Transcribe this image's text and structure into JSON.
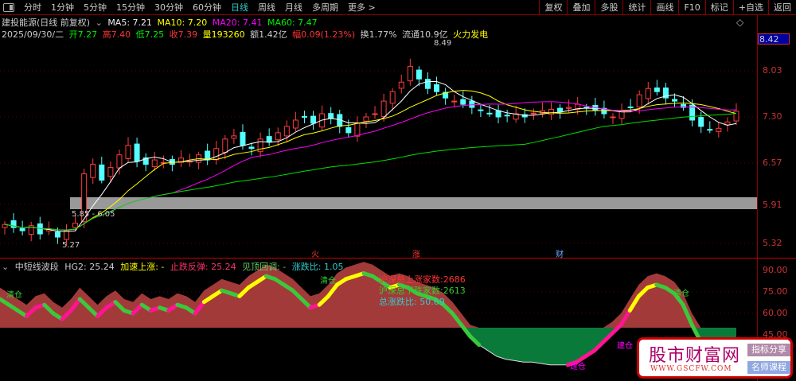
{
  "toolbar": {
    "tabs": [
      "分时",
      "1分钟",
      "5分钟",
      "15分钟",
      "30分钟",
      "60分钟",
      "日线",
      "周线",
      "月线",
      "多周期",
      "更多 >"
    ],
    "active": 6,
    "right": [
      "复权",
      "叠加",
      "多股",
      "统计",
      "画线",
      "F10",
      "标记",
      "+自选",
      "返回"
    ]
  },
  "info": {
    "title": "建投能源(日线 前复权)",
    "ma5": "MA5: 7.21",
    "ma10": "MA10: 7.20",
    "ma20": "MA20: 7.41",
    "ma60": "MA60: 7.47",
    "date": "2025/09/30/二",
    "open": "开7.27",
    "high": "高7.40",
    "low": "低7.25",
    "close": "收7.39",
    "vol": "量193260",
    "amt": "额1.42亿",
    "chg": "幅0.09(1.23%)",
    "turn": "换1.77%",
    "float": "流通10.9亿",
    "sector": "火力发电"
  },
  "price_axis": {
    "current": "8.42",
    "ticks": [
      "8.03",
      "7.30",
      "6.57",
      "5.91",
      "5.32"
    ]
  },
  "annotations": {
    "high": "8.49",
    "low": "5.27",
    "band": "5.85 - 6.05",
    "markers": [
      "火",
      "涨",
      "财"
    ]
  },
  "indicator": {
    "name": "中短线波段",
    "hg2": "HG2: 25.24",
    "acc": "加速上涨: -",
    "rebound": "止跌反弹: 25.24",
    "top": "见顶回调: -",
    "ratio": "涨跌比: 1.05",
    "ticks": [
      "90.00",
      "75.00",
      "60.00",
      "45.00"
    ],
    "up": "沪深总上涨家数:2686",
    "down": "沪深总下跌家数:2613",
    "total": "总涨跌比: 50.69",
    "labels": [
      "清仓",
      "建仓"
    ]
  },
  "watermark": {
    "name": "股市财富网",
    "url": "WWW.GSCFW.COM",
    "b1": "指标分享",
    "b2": "名师课程"
  },
  "colors": {
    "up": "#ff3c3c",
    "down": "#54ffff",
    "ma5": "#ffffff",
    "ma10": "#ffff00",
    "ma20": "#ff00ff",
    "ma60": "#00e000"
  },
  "closes": [
    5.6,
    5.55,
    5.5,
    5.58,
    5.45,
    5.52,
    5.4,
    5.5,
    5.62,
    6.4,
    6.55,
    6.3,
    6.5,
    6.7,
    6.85,
    6.6,
    6.55,
    6.62,
    6.58,
    6.55,
    6.65,
    6.6,
    6.7,
    6.62,
    6.8,
    6.95,
    7.0,
    6.85,
    6.8,
    6.95,
    6.9,
    7.05,
    7.15,
    7.25,
    7.3,
    7.2,
    7.35,
    7.28,
    7.15,
    7.05,
    7.2,
    7.3,
    7.35,
    7.55,
    7.7,
    7.85,
    8.1,
    7.9,
    7.75,
    7.7,
    7.6,
    7.55,
    7.5,
    7.45,
    7.4,
    7.35,
    7.3,
    7.32,
    7.35,
    7.3,
    7.36,
    7.4,
    7.42,
    7.38,
    7.45,
    7.5,
    7.44,
    7.4,
    7.35,
    7.3,
    7.4,
    7.45,
    7.65,
    7.75,
    7.7,
    7.6,
    7.55,
    7.45,
    7.25,
    7.15,
    7.1,
    7.12,
    7.22,
    7.39
  ],
  "osc": [
    70,
    66,
    62,
    58,
    64,
    66,
    60,
    56,
    62,
    70,
    64,
    58,
    64,
    68,
    62,
    60,
    66,
    62,
    64,
    62,
    66,
    64,
    60,
    68,
    72,
    76,
    74,
    72,
    78,
    82,
    86,
    84,
    80,
    76,
    70,
    64,
    66,
    72,
    80,
    84,
    86,
    88,
    86,
    82,
    78,
    80,
    78,
    74,
    72,
    70,
    66,
    60,
    52,
    44,
    38,
    34,
    30,
    28,
    27,
    26,
    26,
    25,
    24,
    24,
    24,
    26,
    30,
    34,
    40,
    46,
    52,
    62,
    72,
    78,
    80,
    78,
    74,
    66,
    52,
    40,
    30,
    26,
    24,
    25
  ]
}
